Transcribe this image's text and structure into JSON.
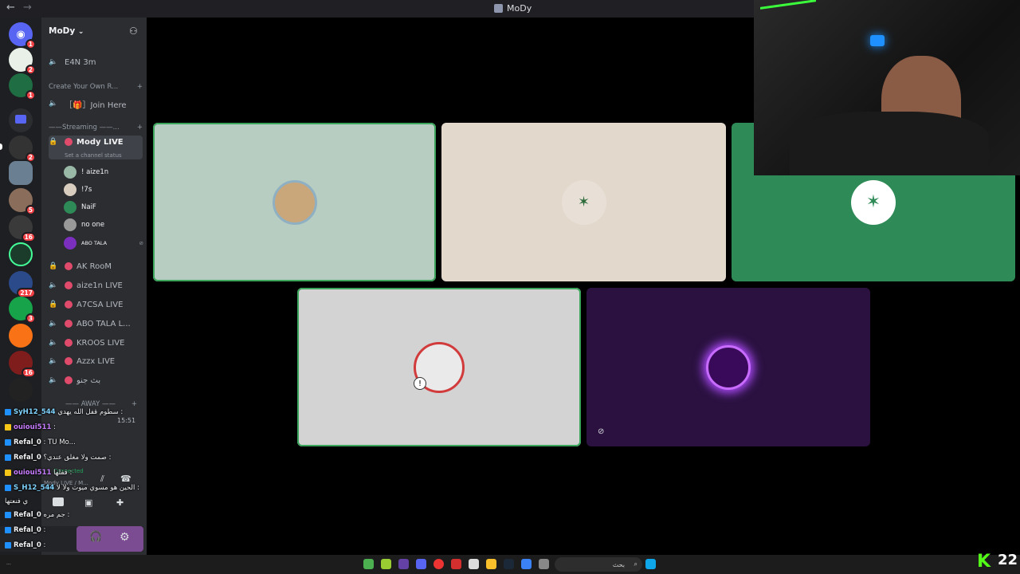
{
  "window": {
    "title": "MoDy",
    "back": "←",
    "forward": "→"
  },
  "server": {
    "name": "MoDy",
    "chevron": "⌄"
  },
  "rail": {
    "badges": [
      "1",
      "2",
      "1",
      "2",
      "5",
      "16",
      "217",
      "3",
      "16"
    ]
  },
  "channels": {
    "top_channel": "E4N 3m",
    "category_create": "Create Your Own R...",
    "join_here": "［🎁］Join Here",
    "category_streaming": "——Streaming ——...",
    "active": {
      "name": "Mody LIVE",
      "status": "Set a channel status"
    },
    "members": [
      "! aize1n",
      "!7s",
      "NaiF",
      "no one",
      "ABO TALA"
    ],
    "list": [
      "AK RooM",
      "aize1n LIVE",
      "A7CSA LIVE",
      "ABO TALA L...",
      "KROOS LIVE",
      "Azzx LIVE",
      "بث جنو"
    ],
    "category_away": "—— AWAY ——"
  },
  "voice_panel": {
    "time": "15:51",
    "connection": "Connected",
    "channel": "Mody LIVE / M..."
  },
  "chat": [
    {
      "user": "SyH12_544",
      "text": "سطوم قفل الله يهدي :"
    },
    {
      "user": "ouioui511",
      "text": ":"
    },
    {
      "user": "Refal_0",
      "text": ": TU Mo..."
    },
    {
      "user": "Refal_0",
      "text": "صمت ولا مغلق عندي؟ :"
    },
    {
      "user": "ouioui511",
      "text": "قفلها :"
    },
    {
      "user": "S_H12_544",
      "text": "الحين هو مسوي ميوت ولا لا :"
    },
    {
      "user": "",
      "text": "ي فنعتها"
    },
    {
      "user": "Refal_0",
      "text": "جم مره :"
    },
    {
      "user": "Refal_0",
      "text": ":"
    },
    {
      "user": "Refal_0",
      "text": ":"
    }
  ],
  "taskbar": {
    "search": "بحث",
    "clock": "22",
    "kick": "K"
  },
  "colors": {
    "tile1": "#b7cdc1",
    "tile2": "#e3d8cc",
    "tile3": "#2e8b57",
    "tile4": "#d3d3d3",
    "tile5": "#2a1140",
    "speaking": "#3ba55c"
  }
}
